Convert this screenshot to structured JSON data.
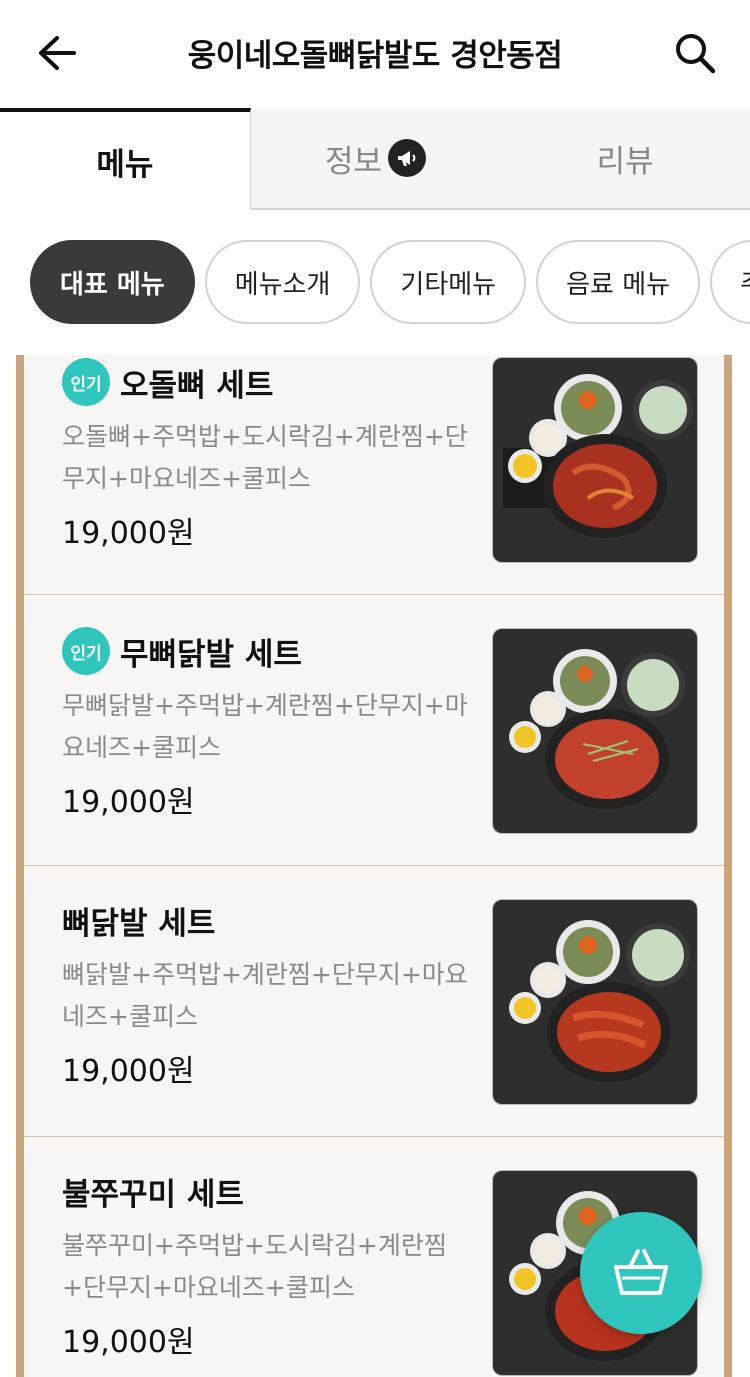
{
  "header": {
    "title": "웅이네오돌뼈닭발도 경안동점"
  },
  "tabs": [
    {
      "label": "메뉴"
    },
    {
      "label": "정보"
    },
    {
      "label": "리뷰"
    }
  ],
  "chips": [
    {
      "label": "대표 메뉴"
    },
    {
      "label": "메뉴소개"
    },
    {
      "label": "기타메뉴"
    },
    {
      "label": "음료 메뉴"
    },
    {
      "label": "주"
    }
  ],
  "menu": {
    "items": [
      {
        "badge": "인기",
        "name": "오돌뼈 세트",
        "desc": "오돌뼈+주먹밥+도시락김+계란찜+단무지+마요네즈+쿨피스",
        "price": "19,000원"
      },
      {
        "badge": "인기",
        "name": "무뼈닭발 세트",
        "desc": "무뼈닭발+주먹밥+계란찜+단무지+마요네즈+쿨피스",
        "price": "19,000원"
      },
      {
        "badge": "",
        "name": "뼈닭발 세트",
        "desc": "뼈닭발+주먹밥+계란찜+단무지+마요네즈+쿨피스",
        "price": "19,000원"
      },
      {
        "badge": "",
        "name": "불쭈꾸미 세트",
        "desc": "불쭈꾸미+주먹밥+도시락김+계란찜+단무지+마요네즈+쿨피스",
        "price": "19,000원"
      }
    ]
  },
  "icons": {
    "back": "arrow-left-icon",
    "search": "search-icon",
    "info": "megaphone-icon",
    "cart": "basket-icon"
  },
  "colors": {
    "accent": "#2fc6be",
    "chip_active": "#3a3a3a",
    "frame": "#c9a47c"
  }
}
